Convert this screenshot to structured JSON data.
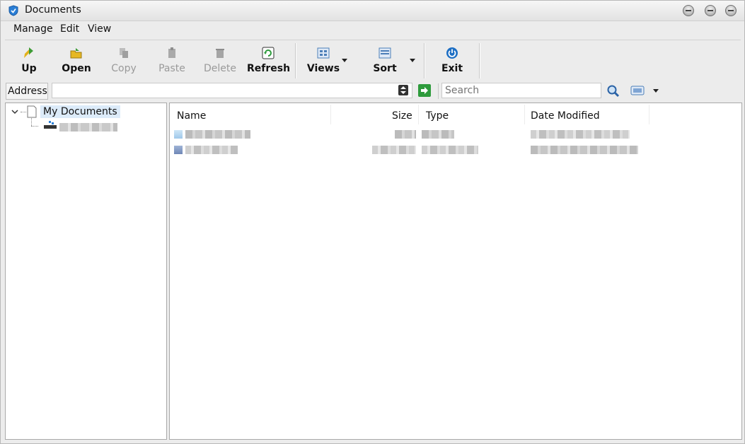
{
  "window": {
    "title": "Documents"
  },
  "menubar": {
    "items": [
      "Manage",
      "Edit",
      "View"
    ]
  },
  "toolbar": {
    "up": "Up",
    "open": "Open",
    "copy": "Copy",
    "paste": "Paste",
    "delete": "Delete",
    "refresh": "Refresh",
    "views": "Views",
    "sort": "Sort",
    "exit": "Exit"
  },
  "address": {
    "label": "Address",
    "value": "",
    "search_placeholder": "Search"
  },
  "tree": {
    "root": "My Documents"
  },
  "list": {
    "columns": [
      "Name",
      "Size",
      "Type",
      "Date Modified"
    ],
    "rows_note_hidden": true
  },
  "colors": {
    "selection": "#dcebf9",
    "accent": "#1e6fc4"
  }
}
